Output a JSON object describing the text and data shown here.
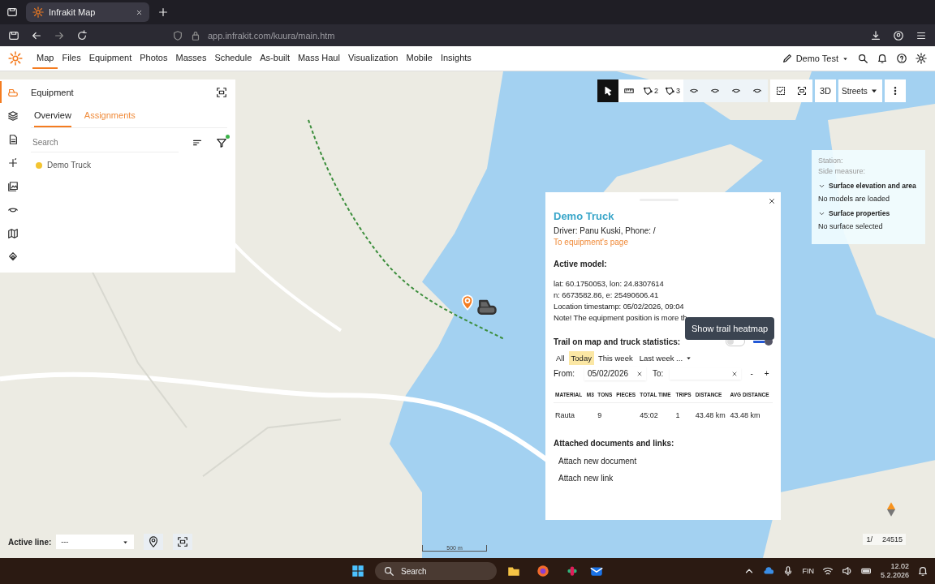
{
  "browser": {
    "tab_title": "Infrakit Map",
    "url": "app.infrakit.com/kuura/main.htm"
  },
  "nav": {
    "items": [
      {
        "label": "Map",
        "selected": true
      },
      {
        "label": "Files",
        "selected": false
      },
      {
        "label": "Equipment",
        "selected": false
      },
      {
        "label": "Photos",
        "selected": false
      },
      {
        "label": "Masses",
        "selected": false
      },
      {
        "label": "Schedule",
        "selected": false
      },
      {
        "label": "As-built",
        "selected": false
      },
      {
        "label": "Mass Haul",
        "selected": false
      },
      {
        "label": "Visualization",
        "selected": false
      },
      {
        "label": "Mobile",
        "selected": false
      },
      {
        "label": "Insights",
        "selected": false
      }
    ],
    "user": "Demo Test"
  },
  "rail": [
    {
      "kind": "equipment",
      "selected": true
    },
    {
      "kind": "layers",
      "selected": false
    },
    {
      "kind": "document",
      "selected": false
    },
    {
      "kind": "point",
      "selected": false
    },
    {
      "kind": "photos",
      "selected": false
    },
    {
      "kind": "profile",
      "selected": false
    },
    {
      "kind": "map",
      "selected": false
    },
    {
      "kind": "stack",
      "selected": false
    }
  ],
  "equipment_panel": {
    "title": "Equipment",
    "tabs": [
      {
        "label": "Overview",
        "selected": true
      },
      {
        "label": "Assignments",
        "selected": false
      }
    ],
    "search": {
      "placeholder": "Search"
    },
    "items": [
      {
        "name": "Demo Truck",
        "color": "#f3c431"
      }
    ]
  },
  "toolbar": [
    {
      "kind": "select",
      "selected": true
    },
    {
      "kind": "ruler",
      "selected": false
    },
    {
      "kind": "polygon",
      "label": "2",
      "selected": false
    },
    {
      "kind": "polygon",
      "label": "3",
      "selected": false
    },
    {
      "kind": "profile",
      "selected": false
    },
    {
      "kind": "profile",
      "selected": false
    },
    {
      "kind": "profile",
      "selected": false
    },
    {
      "kind": "profile",
      "selected": false
    },
    {
      "kind": "check",
      "selected": false
    },
    {
      "kind": "fit",
      "selected": false
    },
    {
      "kind": "text",
      "label": "3D",
      "selected": false
    },
    {
      "kind": "dropdown",
      "label": "Streets",
      "selected": false
    },
    {
      "kind": "more",
      "selected": false
    }
  ],
  "info_panel": {
    "station": "Station:",
    "side_measure": "Side measure:",
    "sections": [
      {
        "title": "Surface elevation and area",
        "expanded": true,
        "text": "No models are loaded"
      },
      {
        "title": "Surface properties",
        "expanded": true,
        "text": "No surface selected"
      }
    ]
  },
  "popup": {
    "title": "Demo Truck",
    "driver": "Driver: Panu Kuski, Phone: /",
    "link": "To equipment's page",
    "active_model": "Active model:",
    "details": [
      "lat: 60.1750053, lon: 24.8307614",
      "n: 6673582.86, e: 25490606.41",
      "Location timestamp: 05/02/2026, 09:04",
      "Note! The equipment position is more th"
    ],
    "trail_label": "Trail on map and truck statistics:",
    "heatmap_toggle": {
      "on": false
    },
    "trail_toggle": {
      "on": true
    },
    "tooltip": "Show trail heatmap",
    "periods": [
      {
        "label": "All",
        "selected": false
      },
      {
        "label": "Today",
        "selected": true
      },
      {
        "label": "This week",
        "selected": false
      }
    ],
    "period_dropdown": "Last week ...",
    "from_label": "From:",
    "from_value": "05/02/2026",
    "to_label": "To:",
    "minus": "-",
    "plus": "+",
    "table": {
      "columns": [
        "MATERIAL",
        "M3",
        "TONS",
        "PIECES",
        "TOTAL TIME",
        "TRIPS",
        "DISTANCE",
        "AVG DISTANCE"
      ],
      "rows": [
        [
          "Rauta",
          "",
          "9",
          "",
          "45:02",
          "1",
          "43.48 km",
          "43.48 km"
        ]
      ]
    },
    "attachments_heading": "Attached documents and links:",
    "actions": [
      "Attach new document",
      "Attach new link"
    ]
  },
  "bottom": {
    "active_line_label": "Active line:",
    "active_line_value": "---",
    "scale": "500 m",
    "page": "1/",
    "count": "24515"
  },
  "taskbar": {
    "search": "Search",
    "language": "FIN",
    "time": "12.02",
    "date": "5.2.2026"
  }
}
